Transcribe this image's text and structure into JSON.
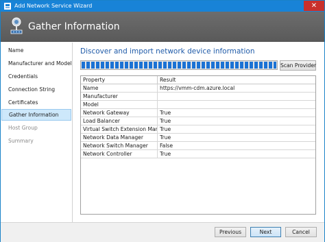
{
  "window": {
    "title": "Add Network Service Wizard",
    "close_glyph": "✕"
  },
  "banner": {
    "title": "Gather Information",
    "icon": "network-service-icon"
  },
  "sidebar": {
    "items": [
      {
        "label": "Name",
        "state": "normal"
      },
      {
        "label": "Manufacturer and Model",
        "state": "normal"
      },
      {
        "label": "Credentials",
        "state": "normal"
      },
      {
        "label": "Connection String",
        "state": "normal"
      },
      {
        "label": "Certificates",
        "state": "normal"
      },
      {
        "label": "Gather Information",
        "state": "active"
      },
      {
        "label": "Host Group",
        "state": "disabled"
      },
      {
        "label": "Summary",
        "state": "disabled"
      }
    ]
  },
  "main": {
    "heading": "Discover and import network device information",
    "progress": {
      "value_percent": 100
    },
    "scan_button": "Scan Provider",
    "table": {
      "columns": [
        "Property",
        "Result"
      ],
      "rows": [
        [
          "Name",
          "https://vmm-cdm.azure.local"
        ],
        [
          "Manufacturer",
          ""
        ],
        [
          "Model",
          ""
        ],
        [
          "Network Gateway",
          "True"
        ],
        [
          "Load Balancer",
          "True"
        ],
        [
          "Virtual Switch Extension Manager",
          "True"
        ],
        [
          "Network Data Manager",
          "True"
        ],
        [
          "Network Switch Manager",
          "False"
        ],
        [
          "Network Controller",
          "True"
        ]
      ]
    }
  },
  "footer": {
    "previous": "Previous",
    "next": "Next",
    "cancel": "Cancel"
  },
  "colors": {
    "accent": "#1883d7",
    "heading": "#1e5aa8",
    "banner": "#5f5f5f",
    "progress": "#1b72d4",
    "selection": "#cde8fb"
  }
}
